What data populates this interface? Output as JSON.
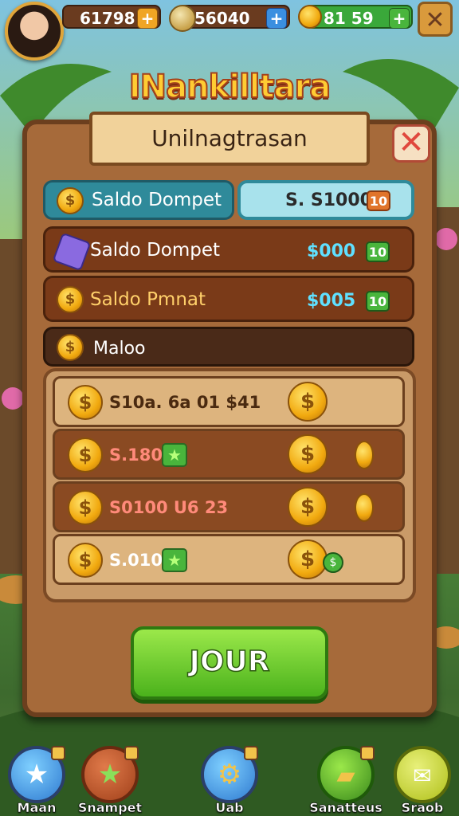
{
  "topbar": {
    "resource_1": "61798",
    "resource_2": "56040",
    "resource_3": "81 59",
    "plus": "+",
    "close": "✕"
  },
  "game_title": "INankilltara",
  "panel": {
    "ribbon_title": "Unilnagtrasan",
    "close": "✕",
    "header_row": {
      "label": "Saldo Dompet",
      "value": "S. S1000",
      "badge": "10"
    },
    "rows": [
      {
        "label": "Saldo Dompet",
        "value": "$000",
        "badge": "10"
      },
      {
        "label": "Saldo Pmnat",
        "value": "$005",
        "badge": "10"
      }
    ],
    "section_label": "Maloo",
    "list": [
      {
        "text": "S10a. 6a 01 $41"
      },
      {
        "text": "S.180"
      },
      {
        "text": "S0100 U6 23"
      },
      {
        "text": "S.010"
      }
    ],
    "join_label": "JOUR"
  },
  "bottom_nav": [
    {
      "label": "Maan",
      "icon": "star-icon"
    },
    {
      "label": "Snampet",
      "icon": "star-icon"
    },
    {
      "label": "Uab",
      "icon": "gear-icon"
    },
    {
      "label": "Sanatteus",
      "icon": "ticket-icon"
    },
    {
      "label": "Sraob",
      "icon": "chat-icon"
    }
  ],
  "colors": {
    "accent_green": "#4bb21c",
    "panel_brown": "#a66a3a",
    "title_gold": "#ffcc33",
    "value_teal": "#5fe0ff"
  }
}
